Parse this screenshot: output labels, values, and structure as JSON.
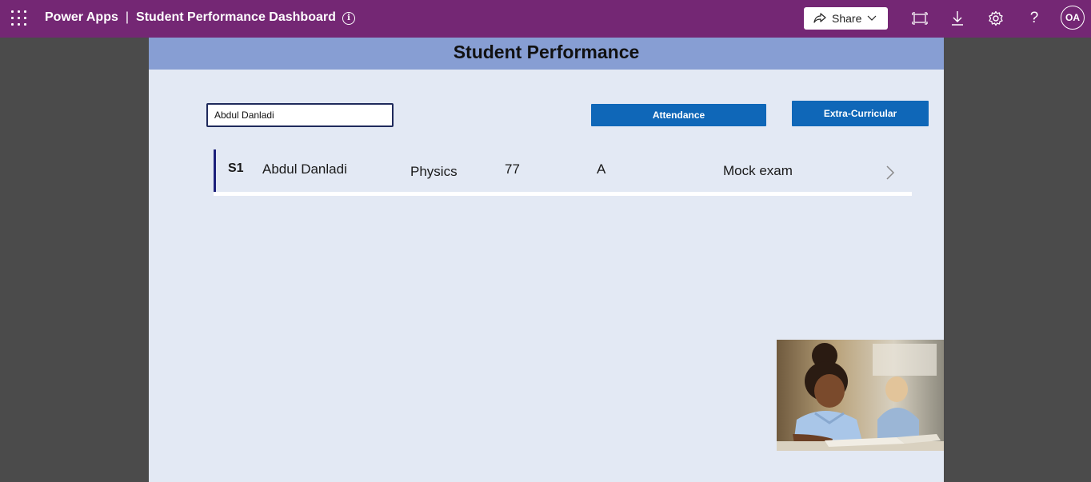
{
  "topbar": {
    "app_name": "Power Apps",
    "separator": "|",
    "app_title": "Student Performance Dashboard",
    "info_icon": "info-icon",
    "share_label": "Share",
    "avatar_initials": "OA",
    "color": "#742774"
  },
  "screen": {
    "title": "Student Performance",
    "header_color": "#879ed3",
    "background_color": "#e3e9f4"
  },
  "search": {
    "value": "Abdul Danladi"
  },
  "buttons": {
    "attendance": "Attendance",
    "extra_curricular": "Extra-Curricular",
    "color": "#0f67b8"
  },
  "gallery": {
    "rows": [
      {
        "id": "S1",
        "name": "Abdul Danladi",
        "subject": "Physics",
        "score": "77",
        "grade": "A",
        "exam": "Mock exam"
      }
    ]
  },
  "image": {
    "subject": "student-reading-photo"
  }
}
